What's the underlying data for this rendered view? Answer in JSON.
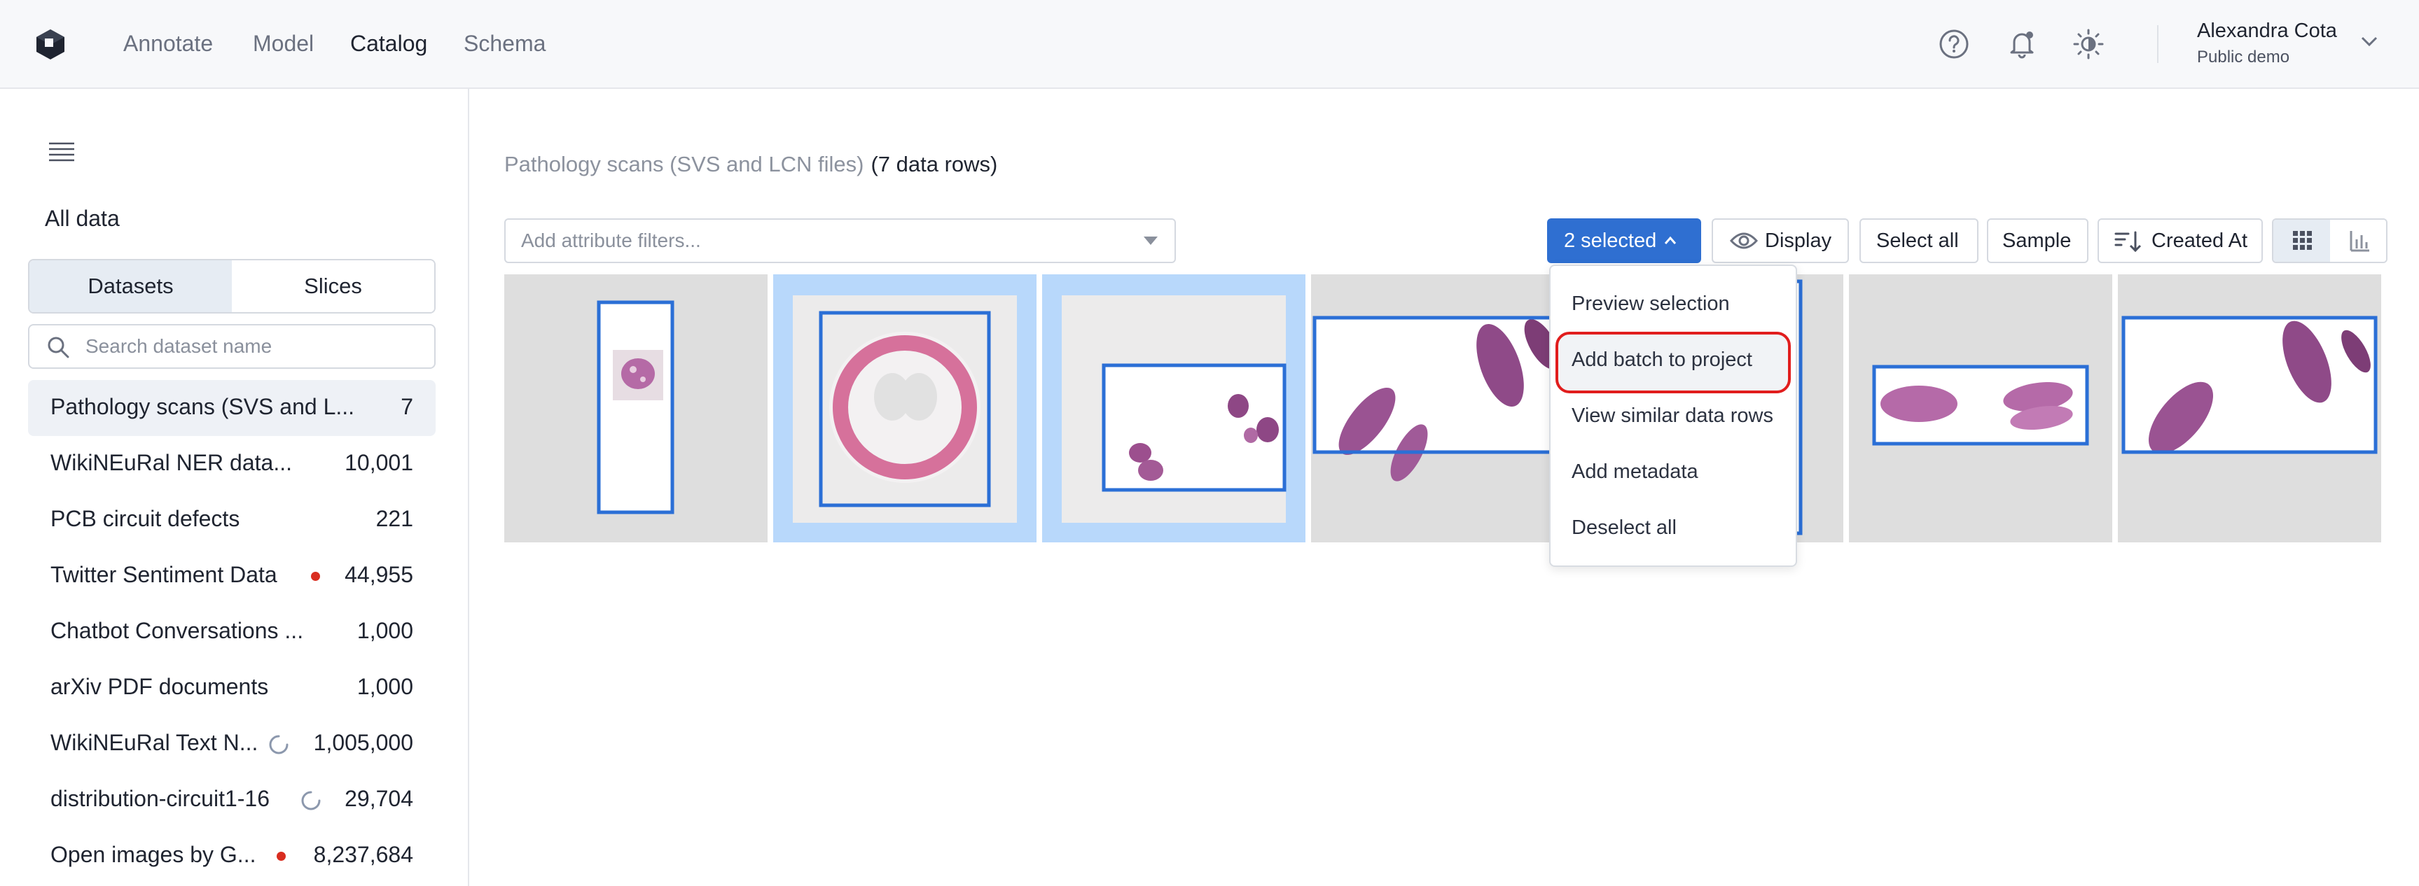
{
  "topbar": {
    "nav": [
      {
        "label": "Annotate",
        "active": false
      },
      {
        "label": "Model",
        "active": false
      },
      {
        "label": "Catalog",
        "active": true
      },
      {
        "label": "Schema",
        "active": false
      }
    ],
    "icons": [
      "help-icon",
      "notification-bell-icon",
      "theme-toggle-icon"
    ],
    "user": {
      "name": "Alexandra Cota",
      "org": "Public demo"
    }
  },
  "sidebar": {
    "all_data": "All data",
    "tabs": [
      {
        "label": "Datasets",
        "active": true
      },
      {
        "label": "Slices",
        "active": false
      }
    ],
    "search_placeholder": "Search dataset name",
    "datasets": [
      {
        "name": "Pathology scans (SVS and L...",
        "count": "7",
        "status": "none"
      },
      {
        "name": "WikiNEuRal NER data...",
        "count": "10,001",
        "status": "none"
      },
      {
        "name": "PCB circuit defects",
        "count": "221",
        "status": "none"
      },
      {
        "name": "Twitter Sentiment Data",
        "count": "44,955",
        "status": "error"
      },
      {
        "name": "Chatbot Conversations ...",
        "count": "1,000",
        "status": "none"
      },
      {
        "name": "arXiv PDF documents",
        "count": "1,000",
        "status": "none"
      },
      {
        "name": "WikiNEuRal Text N...",
        "count": "1,005,000",
        "status": "loading"
      },
      {
        "name": "distribution-circuit1-16",
        "count": "29,704",
        "status": "loading"
      },
      {
        "name": "Open images by G...",
        "count": "8,237,684",
        "status": "error"
      }
    ]
  },
  "main": {
    "title": "Pathology scans (SVS and LCN files)",
    "row_count": "(7 data rows)",
    "filter_placeholder": "Add attribute filters...",
    "toolbar": {
      "selected_label": "2 selected",
      "display_label": "Display",
      "select_all_label": "Select all",
      "sample_label": "Sample",
      "sort_label": "Created At"
    },
    "dropdown": [
      "Preview selection",
      "Add batch to project",
      "View similar data rows",
      "Add metadata",
      "Deselect all"
    ],
    "thumbnails": [
      {
        "selected": false
      },
      {
        "selected": true
      },
      {
        "selected": true
      },
      {
        "selected": false
      },
      {
        "selected": false
      },
      {
        "selected": false
      },
      {
        "selected": false
      }
    ]
  },
  "colors": {
    "accent": "#2f6fd1",
    "selected_bg": "#b8d8fb",
    "highlight": "#e11d1d",
    "status_error": "#d92d20"
  }
}
